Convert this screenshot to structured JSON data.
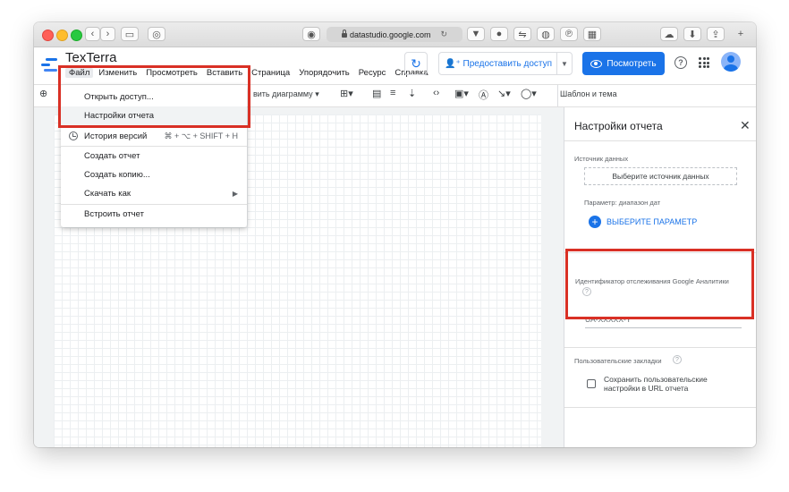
{
  "browser": {
    "url": "datastudio.google.com",
    "reload_icon": "reload-icon"
  },
  "header": {
    "title": "TexTerra",
    "menu": [
      "Файл",
      "Изменить",
      "Просмотреть",
      "Вставить",
      "Страница",
      "Упорядочить",
      "Ресурс",
      "Справка"
    ],
    "share_label": "Предоставить доступ",
    "view_label": "Посмотреть",
    "help_symbol": "?"
  },
  "toolbar": {
    "add_chart": "вить диаграмму",
    "theme_label": "Шаблон и тема"
  },
  "file_menu": {
    "items": [
      {
        "label": "Открыть доступ..."
      },
      {
        "label": "Настройки отчета"
      },
      {
        "label": "История версий",
        "shortcut": "⌘ + ⌥ + SHIFT + H"
      },
      {
        "label": "Создать отчет"
      },
      {
        "label": "Создать копию..."
      },
      {
        "label": "Скачать как"
      },
      {
        "label": "Встроить отчет"
      }
    ]
  },
  "panel": {
    "title": "Настройки отчета",
    "data_source_label": "Источник данных",
    "data_source_button": "Выберите источник данных",
    "date_param_label": "Параметр: диапазон дат",
    "add_param_label": "ВЫБЕРИТЕ ПАРАМЕТР",
    "ga_label": "Идентификатор отслеживания Google Аналитики",
    "ga_placeholder": "UA-XXXXX-Y",
    "bookmarks_label": "Пользовательские закладки",
    "save_bookmarks_label": "Сохранить пользовательские настройки в URL отчета"
  },
  "colors": {
    "accent": "#1a73e8",
    "highlight": "#d93025"
  }
}
